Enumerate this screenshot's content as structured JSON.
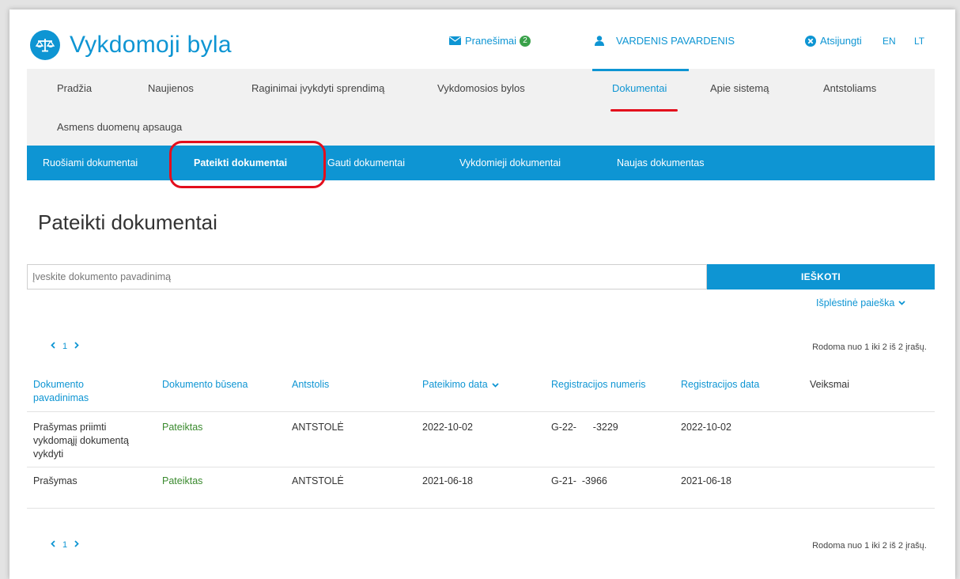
{
  "header": {
    "app_title": "Vykdomoji byla",
    "messages_label": "Pranešimai",
    "messages_count": "2",
    "user_name": "VARDENIS PAVARDENIS",
    "logout_label": "Atsijungti",
    "lang_en": "EN",
    "lang_lt": "LT"
  },
  "main_nav": {
    "items": [
      "Pradžia",
      "Naujienos",
      "Raginimai įvykdyti sprendimą",
      "Vykdomosios bylos",
      "Dokumentai",
      "Apie sistemą",
      "Antstoliams",
      "Asmens duomenų apsauga"
    ],
    "active": "Dokumentai"
  },
  "sub_nav": {
    "items": [
      "Ruošiami dokumentai",
      "Pateikti dokumentai",
      "Gauti dokumentai",
      "Vykdomieji dokumentai",
      "Naujas dokumentas"
    ],
    "active": "Pateikti dokumentai"
  },
  "page_title": "Pateikti dokumentai",
  "search": {
    "placeholder": "Įveskite dokumento pavadinimą",
    "button_label": "IEŠKOTI",
    "advanced_label": "Išplėstinė paieška"
  },
  "pagination": {
    "prev": "‹",
    "page": "1",
    "next": "›",
    "count_text": "Rodoma nuo 1 iki 2 iš 2 įrašų."
  },
  "table": {
    "columns": [
      "Dokumento pavadinimas",
      "Dokumento būsena",
      "Antstolis",
      "Pateikimo data",
      "Registracijos numeris",
      "Registracijos data",
      "Veiksmai"
    ],
    "rows": [
      {
        "name": "Prašymas priimti vykdomąjį dokumentą vykdyti",
        "status": "Pateiktas",
        "bailiff": "ANTSTOLĖ",
        "submitted": "2022-10-02",
        "reg_number": "G-22-      -3229",
        "reg_date": "2022-10-02"
      },
      {
        "name": "Prašymas",
        "status": "Pateiktas",
        "bailiff": "ANTSTOLĖ",
        "submitted": "2021-06-18",
        "reg_number": "G-21-  -3966",
        "reg_date": "2021-06-18"
      }
    ]
  },
  "colors": {
    "accent": "#0e95d3",
    "status_green": "#3a8a2e",
    "highlight_red": "#e30e1c",
    "badge_green": "#3aa14a"
  },
  "icons": [
    "scales-icon",
    "envelope-icon",
    "user-icon",
    "close-circle-icon",
    "chevron-down-icon",
    "chevron-left-icon",
    "chevron-right-icon"
  ]
}
